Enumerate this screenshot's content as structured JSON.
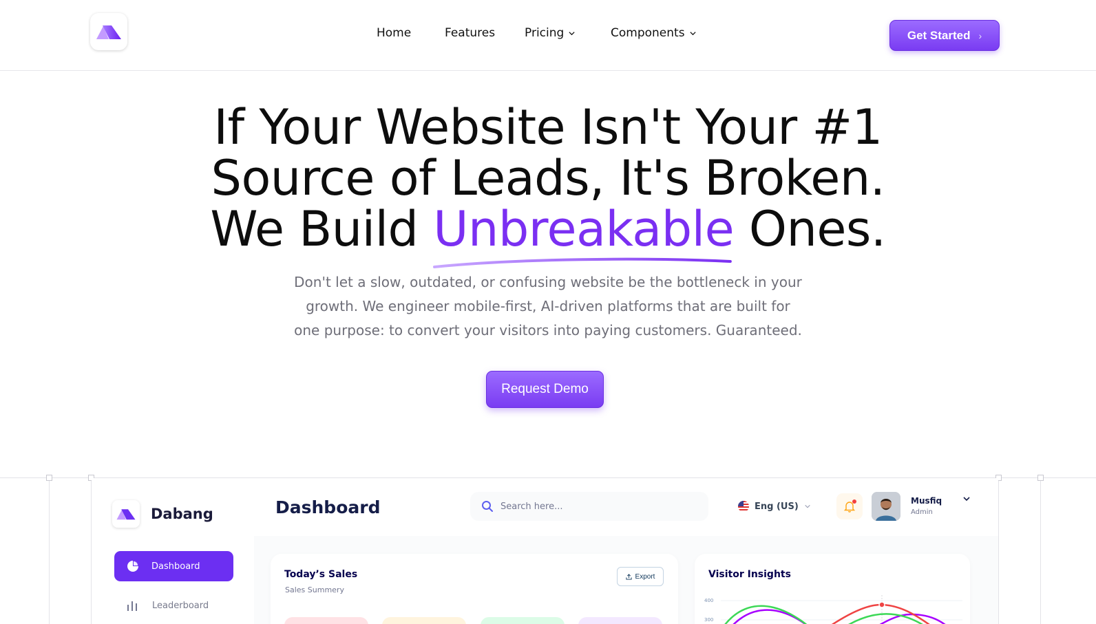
{
  "nav": {
    "links": [
      {
        "label": "Home"
      },
      {
        "label": "Features"
      },
      {
        "label": "Pricing"
      },
      {
        "label": "Components"
      }
    ],
    "cta_label": "Get Started",
    "cta_arrow": "›"
  },
  "hero": {
    "line1": "If Your Website Isn't Your #1",
    "line2": "Source of Leads, It's Broken.",
    "line3_start": "We Build ",
    "line3_highlight": "Unbreakable",
    "line3_end": " Ones.",
    "subtitle_1": "Don't let a slow, outdated, or confusing website be the bottleneck in your",
    "subtitle_2": "growth. We engineer mobile-first, AI-driven platforms that are built for",
    "subtitle_3": "one purpose: to convert your visitors into paying customers. Guaranteed.",
    "cta_label": "Request Demo"
  },
  "colors": {
    "accent": "#7a2ff2",
    "button_top": "#9b6bff",
    "button_bottom": "#7a3cf2",
    "dashboard_accent": "#6c2ff2"
  },
  "dashboard": {
    "brand": "Dabang",
    "title": "Dashboard",
    "search_placeholder": "Search here...",
    "language": "Eng (US)",
    "user_name": "Musfiq",
    "user_role": "Admin",
    "sidebar": {
      "active_label": "Dashboard",
      "active_icon": "pie-chart-icon",
      "item_label": "Leaderboard",
      "item_icon": "bar-chart-icon"
    },
    "sales_card": {
      "title": "Today’s Sales",
      "subtitle": "Sales Summery",
      "export_label": "Export",
      "mini_colors": [
        "#ffe2e5",
        "#fff4de",
        "#dcfce7",
        "#f3e8ff"
      ],
      "mini_dot_colors": [
        "#fa5a7d",
        "#ff947a",
        "#3cd856",
        "#bf83ff"
      ]
    },
    "visitor_card": {
      "title": "Visitor Insights",
      "y_ticks": [
        "400",
        "300"
      ]
    }
  }
}
